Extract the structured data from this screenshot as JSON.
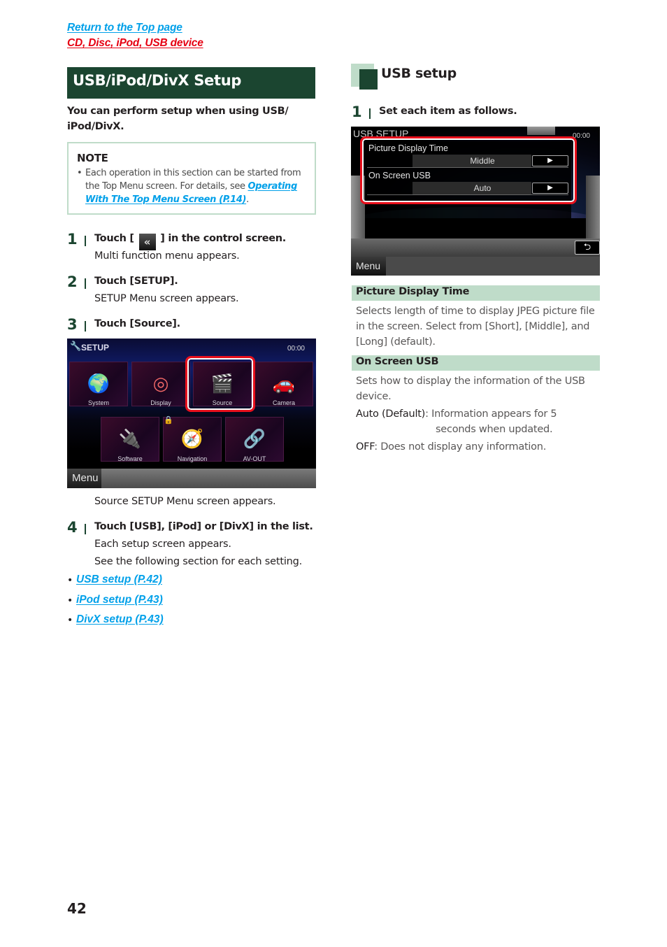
{
  "nav": {
    "top_link": "Return to the Top page",
    "section_link": "CD, Disc, iPod, USB device"
  },
  "section": {
    "title": "USB/iPod/DivX Setup",
    "intro": "You can perform setup when using USB/ iPod/DivX."
  },
  "note": {
    "title": "NOTE",
    "bullet": "•",
    "text_before": "Each operation in this section can be started from the Top Menu screen. For details, see ",
    "link": "Operating With The Top Menu Screen (P.14)",
    "text_after": "."
  },
  "steps": [
    {
      "num": "1",
      "title_before": "Touch [ ",
      "icon": "double-chevron-left",
      "icon_glyph": "«",
      "title_after": " ] in the control screen.",
      "desc": "Multi function menu appears."
    },
    {
      "num": "2",
      "title": "Touch [SETUP].",
      "desc": "SETUP Menu screen appears."
    },
    {
      "num": "3",
      "title": "Touch [Source].",
      "desc": "Source SETUP Menu screen appears."
    },
    {
      "num": "4",
      "title": "Touch [USB], [iPod] or [DivX] in the list.",
      "desc1": "Each setup screen appears.",
      "desc2": "See the following section for each setting."
    }
  ],
  "setup_screen": {
    "title": "SETUP",
    "clock": "00:00",
    "tiles_row1": [
      "System",
      "Display",
      "Source",
      "Camera"
    ],
    "tiles_row2": [
      "Software",
      "Navigation",
      "AV-OUT"
    ],
    "highlighted": "Source",
    "menu_label": "Menu"
  },
  "links": [
    {
      "bullet": "•",
      "label": "USB setup (P.42)"
    },
    {
      "bullet": "•",
      "label": "iPod setup (P.43)"
    },
    {
      "bullet": "•",
      "label": "DivX setup (P.43)"
    }
  ],
  "usb_setup": {
    "heading": "USB setup",
    "step": {
      "num": "1",
      "title": "Set each item as follows."
    },
    "screen": {
      "title": "USB SETUP",
      "clock": "00:00",
      "rows": [
        {
          "label": "Picture Display Time",
          "value": "Middle",
          "arrow": "▶"
        },
        {
          "label": "On Screen USB",
          "value": "Auto",
          "arrow": "▶"
        }
      ],
      "back_glyph": "⮌",
      "menu_label": "Menu"
    },
    "items": [
      {
        "head": "Picture Display Time",
        "text": "Selects length of time to display JPEG picture file in the screen. Select from [Short], [Middle], and [Long] (default)."
      },
      {
        "head": "On Screen USB",
        "text": "Sets how to display the information of the USB device.",
        "options": [
          {
            "key": "Auto (Default)",
            "sep": ": ",
            "line1": "Information appears for 5",
            "line2": "seconds when updated."
          },
          {
            "key": "OFF",
            "sep": ": ",
            "line1": "Does not display any information."
          }
        ]
      }
    ]
  },
  "footer": {
    "page_number": "42"
  },
  "colors": {
    "brand_green": "#1b4530",
    "light_green": "#bfdcc9",
    "link_blue": "#00a0e9",
    "link_red": "#e60012",
    "highlight_red": "#e8101c"
  }
}
